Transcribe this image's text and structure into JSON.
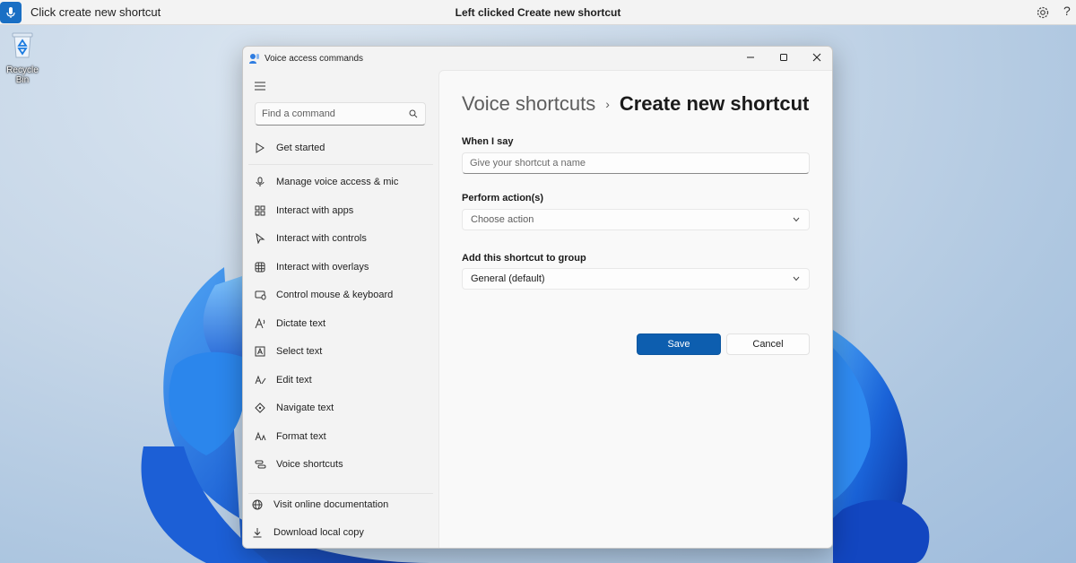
{
  "voice_bar": {
    "status_text": "Click create new shortcut",
    "center_text": "Left clicked Create new shortcut",
    "help_label": "?"
  },
  "desktop": {
    "recycle_bin_label": "Recycle Bin"
  },
  "window": {
    "title": "Voice access commands",
    "minimize_label": "—",
    "close_label": "✕"
  },
  "sidebar": {
    "search_placeholder": "Find a command",
    "items": [
      {
        "label": "Get started",
        "icon": "play-icon"
      },
      {
        "label": "Manage voice access & mic",
        "icon": "microphone-icon"
      },
      {
        "label": "Interact with apps",
        "icon": "apps-grid-icon"
      },
      {
        "label": "Interact with controls",
        "icon": "cursor-icon"
      },
      {
        "label": "Interact with overlays",
        "icon": "overlay-grid-icon"
      },
      {
        "label": "Control mouse & keyboard",
        "icon": "mouse-keyboard-icon"
      },
      {
        "label": "Dictate text",
        "icon": "dictate-icon"
      },
      {
        "label": "Select text",
        "icon": "select-text-icon"
      },
      {
        "label": "Edit text",
        "icon": "edit-text-icon"
      },
      {
        "label": "Navigate text",
        "icon": "navigate-text-icon"
      },
      {
        "label": "Format text",
        "icon": "format-text-icon"
      },
      {
        "label": "Voice shortcuts",
        "icon": "voice-shortcuts-icon"
      }
    ],
    "footer_items": [
      {
        "label": "Visit online documentation",
        "icon": "globe-icon"
      },
      {
        "label": "Download local copy",
        "icon": "download-icon"
      }
    ]
  },
  "main": {
    "breadcrumb_parent": "Voice shortcuts",
    "breadcrumb_separator": "›",
    "breadcrumb_current": "Create new shortcut",
    "when_i_say_label": "When I say",
    "name_placeholder": "Give your shortcut a name",
    "perform_action_label": "Perform action(s)",
    "action_placeholder": "Choose action",
    "group_label": "Add this shortcut to group",
    "group_value": "General (default)",
    "save_label": "Save",
    "cancel_label": "Cancel"
  },
  "colors": {
    "accent": "#0d5eaf",
    "voice_bar_mic": "#1a6fc4"
  }
}
